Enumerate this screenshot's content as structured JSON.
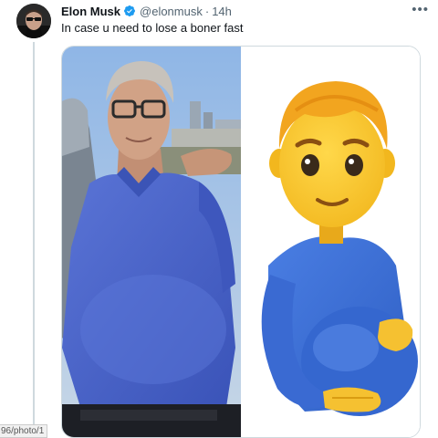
{
  "tweet": {
    "author_name": "Elon Musk",
    "handle": "@elonmusk",
    "separator": "·",
    "time": "14h",
    "text": "In case u need to lose a boner fast",
    "more_icon": "more-horizontal-icon",
    "verified_icon": "verified-badge-icon"
  },
  "media": {
    "left_photo": "photo-man-blue-polo-shirt",
    "right_photo": "pregnant-man-emoji"
  },
  "status_bar": {
    "url_fragment": "96/photo/1"
  },
  "colors": {
    "verified": "#1d9bf0",
    "name": "#0f1419",
    "secondary": "#536471",
    "shirt": "#4a63c9",
    "emoji_body": "#3f6fd6",
    "emoji_skin": "#f7c330"
  }
}
